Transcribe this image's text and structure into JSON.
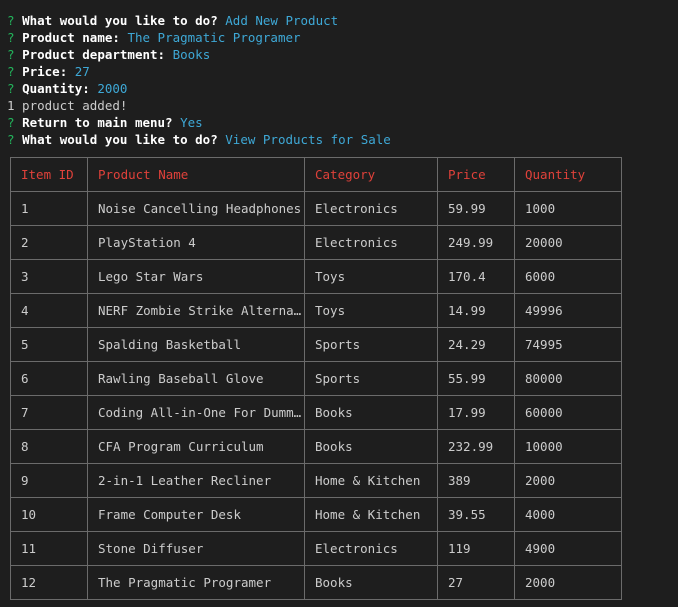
{
  "session": [
    {
      "type": "prompt",
      "marker": "?",
      "question": "What would you like to do?",
      "answer": "Add New Product"
    },
    {
      "type": "prompt",
      "marker": "?",
      "question": "Product name:",
      "answer": "The Pragmatic Programer"
    },
    {
      "type": "prompt",
      "marker": "?",
      "question": "Product department:",
      "answer": "Books"
    },
    {
      "type": "prompt",
      "marker": "?",
      "question": "Price:",
      "answer": "27"
    },
    {
      "type": "prompt",
      "marker": "?",
      "question": "Quantity:",
      "answer": "2000"
    },
    {
      "type": "output",
      "text": "1 product added!"
    },
    {
      "type": "prompt",
      "marker": "?",
      "question": "Return to main menu?",
      "answer": "Yes"
    },
    {
      "type": "prompt",
      "marker": "?",
      "question": "What would you like to do?",
      "answer": "View Products for Sale"
    }
  ],
  "table": {
    "headers": [
      "Item ID",
      "Product Name",
      "Category",
      "Price",
      "Quantity"
    ],
    "rows": [
      [
        "1",
        "Noise Cancelling Headphones",
        "Electronics",
        "59.99",
        "1000"
      ],
      [
        "2",
        "PlayStation 4",
        "Electronics",
        "249.99",
        "20000"
      ],
      [
        "3",
        "Lego Star Wars",
        "Toys",
        "170.4",
        "6000"
      ],
      [
        "4",
        "NERF Zombie Strike Alternat…",
        "Toys",
        "14.99",
        "49996"
      ],
      [
        "5",
        "Spalding Basketball",
        "Sports",
        "24.29",
        "74995"
      ],
      [
        "6",
        "Rawling Baseball Glove",
        "Sports",
        "55.99",
        "80000"
      ],
      [
        "7",
        "Coding All-in-One For Dummi…",
        "Books",
        "17.99",
        "60000"
      ],
      [
        "8",
        "CFA Program Curriculum",
        "Books",
        "232.99",
        "10000"
      ],
      [
        "9",
        "2-in-1 Leather Recliner",
        "Home & Kitchen",
        "389",
        "2000"
      ],
      [
        "10",
        "Frame Computer Desk",
        "Home & Kitchen",
        "39.55",
        "4000"
      ],
      [
        "11",
        "Stone Diffuser",
        "Electronics",
        "119",
        "4900"
      ],
      [
        "12",
        "The Pragmatic Programer",
        "Books",
        "27",
        "2000"
      ]
    ]
  },
  "colors": {
    "background": "#1e1e1e",
    "question_mark": "#23b35b",
    "prompt_text": "#ffffff",
    "answer_text": "#3ea8d6",
    "header_text": "#e0413a",
    "cell_text": "#cccccc",
    "border": "#6b6b6b"
  }
}
